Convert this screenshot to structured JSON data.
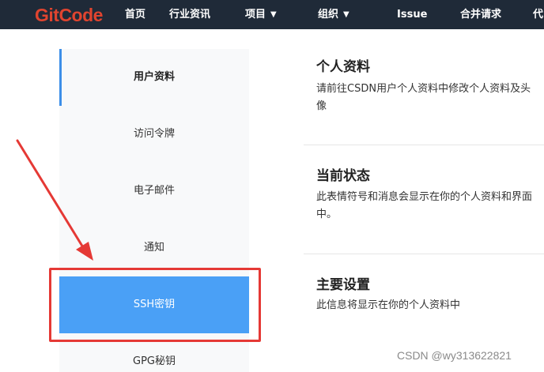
{
  "brand": {
    "logo_text": "GitCode"
  },
  "nav": {
    "items": [
      {
        "label": "首页"
      },
      {
        "label": "行业资讯"
      },
      {
        "label": "项目"
      },
      {
        "label": "组织"
      },
      {
        "label": "Issue"
      },
      {
        "label": "合并请求"
      },
      {
        "label": "代"
      }
    ]
  },
  "sidebar": {
    "items": [
      {
        "label": "用户资料"
      },
      {
        "label": "访问令牌"
      },
      {
        "label": "电子邮件"
      },
      {
        "label": "通知"
      },
      {
        "label": "SSH密钥"
      },
      {
        "label": "GPG秘钥"
      }
    ]
  },
  "content": {
    "sections": [
      {
        "title": "个人资料",
        "desc": "请前往CSDN用户个人资料中修改个人资料及头像"
      },
      {
        "title": "当前状态",
        "desc": "此表情符号和消息会显示在你的个人资料和界面中。"
      },
      {
        "title": "主要设置",
        "desc": "此信息将显示在你的个人资料中"
      }
    ]
  },
  "watermark": {
    "text": "CSDN @wy313622821"
  },
  "colors": {
    "nav_bg": "#1f2a38",
    "brand": "#e0442f",
    "selected": "#4aa0f6",
    "highlight": "#e53935"
  }
}
